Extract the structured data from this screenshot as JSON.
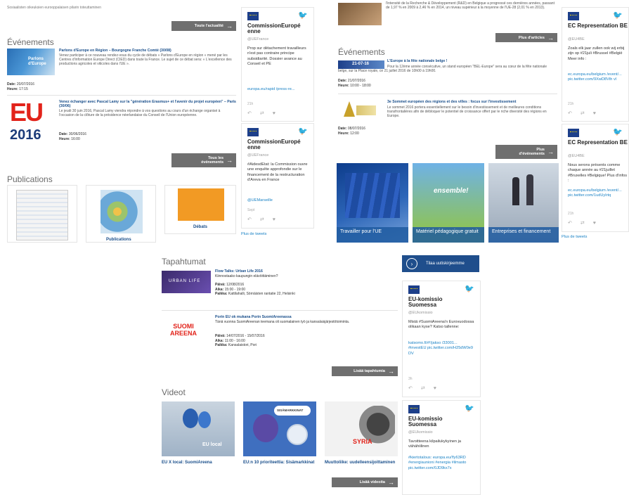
{
  "panel1": {
    "top_text": "Sosiaalisten oikeuksien eurooppalaisen pilarin toteuttaminen",
    "news_btn": "Toute l'actualité",
    "events_title": "Événements",
    "events": [
      {
        "title": "Parlons d'Europe en Région – Bourgogne Franche Comté (30/08)",
        "text": "Venez participer à ce nouveau rendez-vous du cycle de débats « Parlons d'Europe en région » mené par les Centres d'information Europe Direct (CIED) dans toute la France. Le sujet de ce débat sera: « L'excellence des productions agricoles et viticoles dans l'UE ».",
        "date_label": "Date:",
        "date": "20/07/2016",
        "time_label": "Heure:",
        "time": "17:15",
        "thumb_text": "Parlons d'Europe"
      },
      {
        "title": "Venez échanger avec Pascal Lamy sur la \"génération Erasmus+ et l'avenir du projet européen\" – Paris (30/06)",
        "text": "Le jeudi 30 juin 2016, Pascal Lamy viendra répondre à vos questions au cours d'un échange organisé à l'occasion de la clôture de la présidence néerlandaise du Conseil de l'Union européenne.",
        "date_label": "Date:",
        "date": "30/06/2016",
        "time_label": "Heure:",
        "time": "16:00",
        "thumb_text": "2016"
      }
    ],
    "events_btn": "Tous les événements",
    "publications_title": "Publications",
    "pub_caption_2": "Publications",
    "pub_caption_3": "Débats",
    "tweets": [
      {
        "name": "CommissionEuropé enne",
        "handle": "@UEFrance",
        "text": "Prop sur détachement travailleurs n'est pas contraire principe subsidiarité. Dossier avance au Conseil et PE",
        "link": "europa.eu/rapid /press-re...",
        "time": "21h"
      },
      {
        "name": "CommissionEuropé enne",
        "handle": "@UEFrance",
        "text": "#AidesdEtat: la Commission ouvre une enquête approfondie sur le financement de la restructuration d'Areva en France",
        "link": "@UEMarseille",
        "time": "Sept"
      }
    ],
    "more_tweets": "Plus de tweets"
  },
  "panel2": {
    "top_text": "l'intensité de la Recherche & Développement (R&D) en Belgique a progressé ces dernières années, passant de 1,97 % en 2009 à 2,46 % en 2014, un niveau supérieur à la moyenne de l'UE-28 (2,01 % en 2013).",
    "articles_btn": "Plus d'articles",
    "events_title": "Événements",
    "events": [
      {
        "title": "L'Europe à la fête nationale belge !",
        "text": "Pour la 12ème année consécutive, un stand européen \"BEL-Europe\" sera au cœur de la fête nationale belge, sur la Place royale, ce 21 juillet 2016 de 10h00 à 19h00.",
        "date_label": "Date:",
        "date": "21/07/2016",
        "time_label": "Heure:",
        "time": "10:00 - 18:00",
        "thumb_text": "21-07-16"
      },
      {
        "title": "3e Sommet européen des régions et des villes : focus sur l'investissement",
        "text": "Le sommet 2016 portera essentiellement sur le besoin d'investissement et de meilleures conditions transfrontalières afin de débloquer le potentiel de croissance offert par le riche diversité des régions en Europe.",
        "date_label": "Date:",
        "date": "08/07/2016",
        "time_label": "Heure:",
        "time": "12:00",
        "thumb_text": ""
      }
    ],
    "events_btn": "Plus d'événements",
    "tiles": [
      {
        "caption": "Travailler pour l'UE"
      },
      {
        "caption": "Matériel pédagogique gratuit",
        "overlay": "ensemble!"
      },
      {
        "caption": "Entreprises et financement"
      }
    ],
    "tweets": [
      {
        "name": "EC Representation BE",
        "handle": "@EU4BE",
        "text": "Zoals elk jaar zullen ook wij erbij zijn op #21juli #Brussel #België Meer info :",
        "link": "ec.europa.eu/belgium /event/... pic.twitter.com/9XwD8Vth vl",
        "time": "21h"
      },
      {
        "name": "EC Representation BE",
        "handle": "@EU4BE",
        "text": "Nous serons présents comme chaque année au #21juillet #Bruxelles #Belgique! Plus d'infos :",
        "link": "ec.europa.eu/belgium /event/... pic.twitter.com/1udUyIrtq",
        "time": "21h"
      }
    ],
    "more_tweets": "Plus de tweets"
  },
  "panel3": {
    "events_title": "Tapahtumat",
    "subscribe_btn": "Tilaa uutiskirjeemme",
    "events": [
      {
        "title": "Flow Talks: Urban Life 2016",
        "text": "Kiinnostaako kaupungin elävöittäminen?",
        "d_label": "Päivä:",
        "d": "12/08/2016",
        "a_label": "Aika:",
        "a": "15:00 - 19:00",
        "p_label": "Paikka:",
        "p": "Kattilahalli, Sörnäisten rantatie 22, Helsinki",
        "thumb_text": "URBAN LIFE"
      },
      {
        "title": "Porin EU ok mukana Porin SuomiAreenassa",
        "text": "Tänä vuonna SuomiAreenan teemana oli suomalainen työ ja kansalaisjärjestötoiminta.",
        "d_label": "Päivä:",
        "d": "14/07/2016 - 15/07/2016",
        "a_label": "Aika:",
        "a": "11:00 - 16:00",
        "p_label": "Paikka:",
        "p": "Kansalaistori, Pori",
        "thumb_text": "SUOMI AREENA"
      }
    ],
    "events_btn": "Lisää tapahtumia",
    "videos_title": "Videot",
    "videos": [
      {
        "caption": "EU X local: SuomiAreena",
        "overlay": "EU local"
      },
      {
        "caption": "EU:n 10 prioriteettia: Sisämarkkinat",
        "overlay": "SISÄMARKKINAT"
      },
      {
        "caption": "Muuttoliike: uudelleensijoittaminen",
        "overlay": "SYRIA"
      }
    ],
    "videos_btn": "Lisää videoita",
    "tweets": [
      {
        "name": "EU-komissio Suomessa",
        "handle": "@EUkomissio",
        "text": "Mistä #SuomiAreena'n Eurovuodossa olikaan kyse? Katso tallenne:",
        "link": "katsomo.fi/#!/jakso /33001... #investEU pic.twitter.com/H25dW0e9 DV",
        "time": "3h"
      },
      {
        "name": "EU-komissio Suomessa",
        "handle": "@EUkomissio",
        "text": "Tavoitteena kilpailukykyinen ja vähähiilinen",
        "link": "#kiertotalous: europa.eu/!fy63RD #energiaunioni #energia #ilmasto pic.twitter.com/0JD9kx7x",
        "time": ""
      }
    ]
  },
  "colors": {
    "accent_blue": "#1a4f8b",
    "twitter_blue": "#1da1f2",
    "button_grey": "#6f6f6f"
  }
}
